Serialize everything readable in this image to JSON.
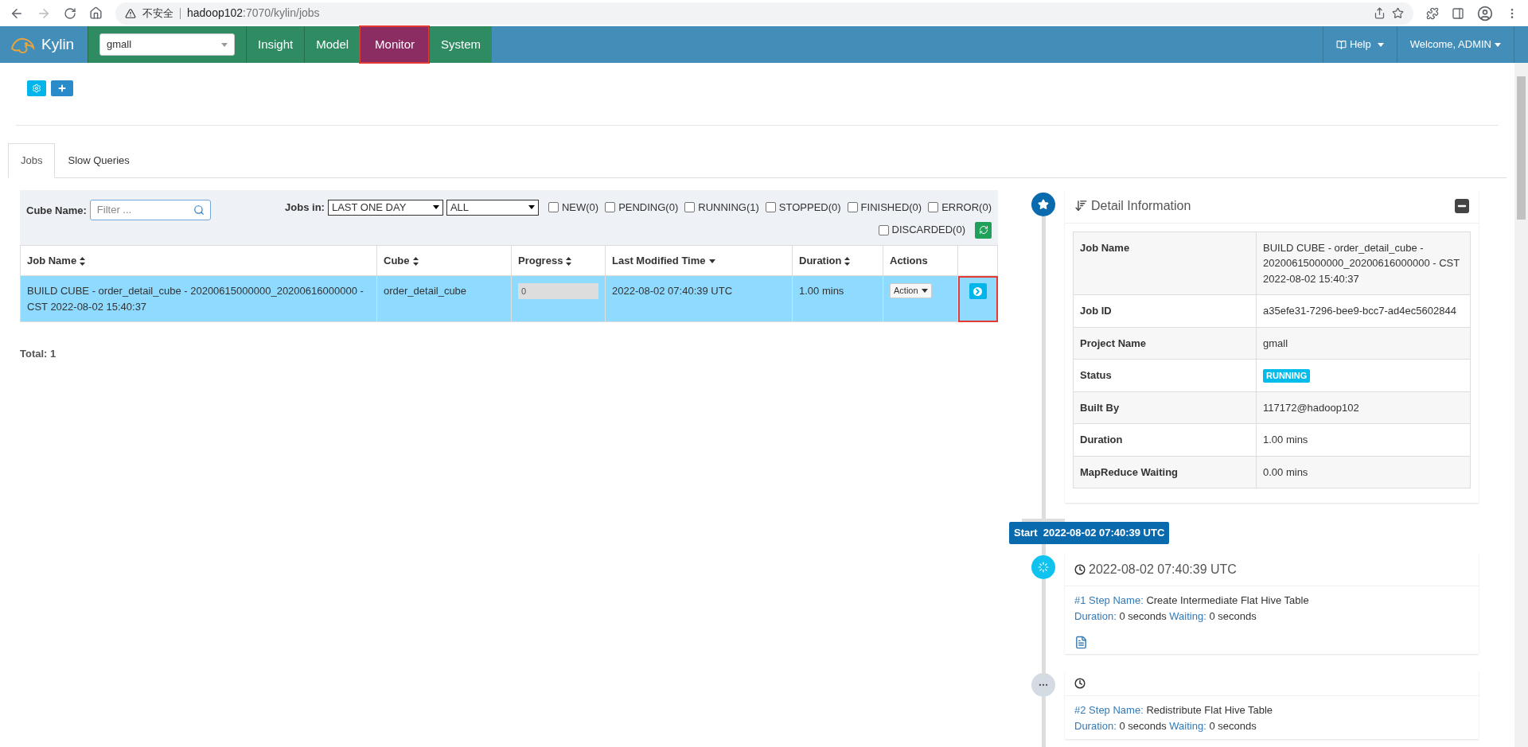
{
  "browser": {
    "security_label": "不安全",
    "url_host": "hadoop102",
    "url_path": ":7070/kylin/jobs"
  },
  "navbar": {
    "brand": "Kylin",
    "project": "gmall",
    "items": [
      {
        "label": "Insight",
        "selected": false,
        "highlighted": false
      },
      {
        "label": "Model",
        "selected": false,
        "highlighted": false
      },
      {
        "label": "Monitor",
        "selected": true,
        "highlighted": true
      },
      {
        "label": "System",
        "selected": false,
        "highlighted": false
      }
    ],
    "help": "Help",
    "user": "Welcome, ADMIN"
  },
  "tabs": [
    {
      "label": "Jobs",
      "selected": true
    },
    {
      "label": "Slow Queries",
      "selected": false
    }
  ],
  "filters": {
    "cube_name_label": "Cube Name:",
    "cube_name_placeholder": "Filter ...",
    "jobs_in_label": "Jobs in:",
    "time_range": "LAST ONE DAY",
    "job_type": "ALL",
    "statuses": [
      {
        "label": "NEW(0)",
        "checked": false
      },
      {
        "label": "PENDING(0)",
        "checked": false
      },
      {
        "label": "RUNNING(1)",
        "checked": false
      },
      {
        "label": "STOPPED(0)",
        "checked": false
      },
      {
        "label": "FINISHED(0)",
        "checked": false
      },
      {
        "label": "ERROR(0)",
        "checked": false
      },
      {
        "label": "DISCARDED(0)",
        "checked": false
      }
    ]
  },
  "table": {
    "columns": [
      {
        "label": "Job Name",
        "kind": "sortable"
      },
      {
        "label": "Cube",
        "kind": "sortable"
      },
      {
        "label": "Progress",
        "kind": "sortable"
      },
      {
        "label": "Last Modified Time",
        "kind": "sorted"
      },
      {
        "label": "Duration",
        "kind": "sortable"
      },
      {
        "label": "Actions",
        "kind": "plain"
      }
    ],
    "rows": [
      {
        "job_name": "BUILD CUBE - order_detail_cube - 20200615000000_20200616000000 - CST 2022-08-02 15:40:37",
        "cube": "order_detail_cube",
        "progress_text": "0",
        "level": 0,
        "modified": "2022-08-02 07:40:39 UTC",
        "duration": "1.00 mins",
        "action": "Action",
        "selected": true,
        "highlighted": true
      }
    ]
  },
  "total": "Total: 1",
  "detail": {
    "title": "Detail Information",
    "fields": [
      {
        "label": "Job Name",
        "value": "BUILD CUBE - order_detail_cube - 20200615000000_20200616000000 - CST 2022-08-02 15:40:37",
        "kind": "text"
      },
      {
        "label": "Job ID",
        "value": "a35efe31-7296-bee9-bcc7-ad4ec5602844",
        "kind": "text"
      },
      {
        "label": "Project Name",
        "value": "gmall",
        "kind": "text"
      },
      {
        "label": "Status",
        "value": "RUNNING",
        "kind": "badge"
      },
      {
        "label": "Built By",
        "value": "117172@hadoop102",
        "kind": "text"
      },
      {
        "label": "Duration",
        "value": "1.00 mins",
        "kind": "text"
      },
      {
        "label": "MapReduce Waiting",
        "value": "0.00 mins",
        "kind": "text"
      }
    ],
    "start": {
      "label": "Start",
      "time": "2022-08-02 07:40:39 UTC"
    },
    "steps": [
      {
        "kind": "running",
        "time": "2022-08-02 07:40:39 UTC",
        "number": "#1",
        "step_name_label": "Step Name:",
        "name": "Create Intermediate Flat Hive Table",
        "duration_label": "Duration:",
        "duration": "0 seconds",
        "waiting_label": "Waiting:",
        "waiting": "0 seconds",
        "log": true
      },
      {
        "kind": "pending",
        "number": "#2",
        "step_name_label": "Step Name:",
        "name": "Redistribute Flat Hive Table",
        "duration_label": "Duration:",
        "duration": "0 seconds",
        "waiting_label": "Waiting:",
        "waiting": "0 seconds",
        "log": false
      }
    ]
  }
}
